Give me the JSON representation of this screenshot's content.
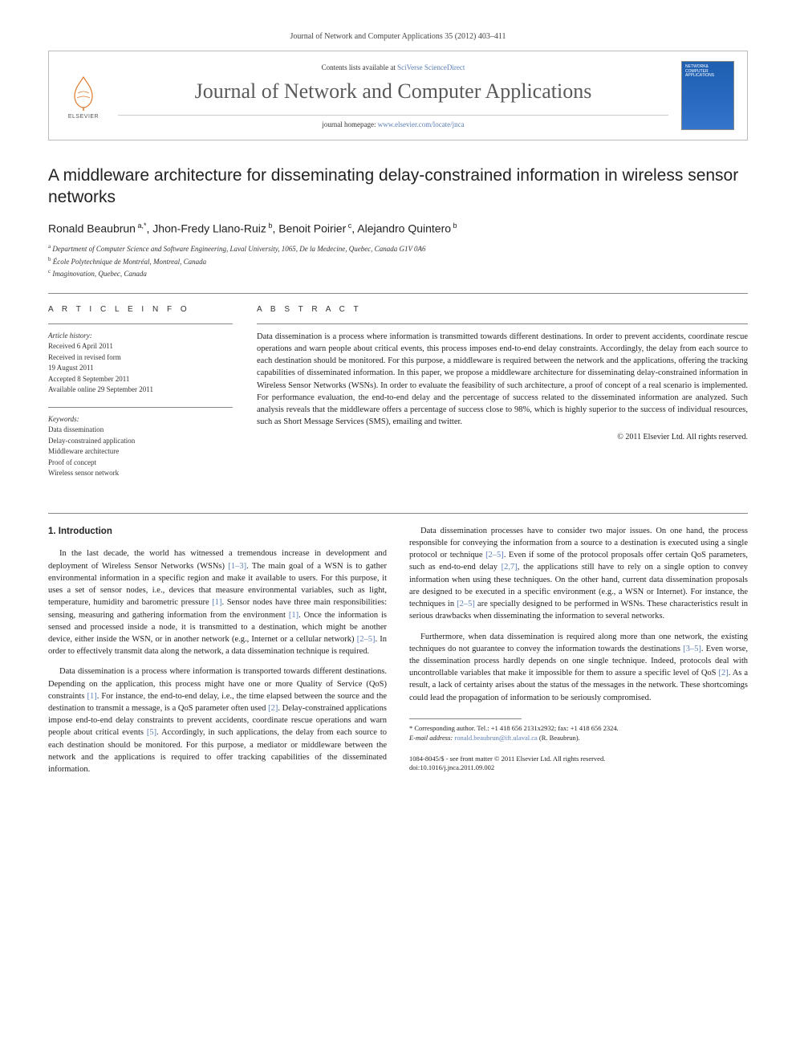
{
  "header_top": "Journal of Network and Computer Applications 35 (2012) 403–411",
  "banner": {
    "contents_prefix": "Contents lists available at ",
    "contents_link": "SciVerse ScienceDirect",
    "journal_title": "Journal of Network and Computer Applications",
    "homepage_prefix": "journal homepage: ",
    "homepage_link": "www.elsevier.com/locate/jnca",
    "elsevier_label": "ELSEVIER",
    "cover_top": "NETWORK& COMPUTER APPLICATIONS"
  },
  "article_title": "A middleware architecture for disseminating delay-constrained information in wireless sensor networks",
  "authors_html": "Ronald Beaubrun <sup>a,</sup>*, Jhon-Fredy Llano-Ruiz <sup>b</sup>, Benoit Poirier <sup>c</sup>, Alejandro Quintero <sup>b</sup>",
  "affiliations": [
    {
      "sup": "a",
      "text": "Department of Computer Science and Software Engineering, Laval University, 1065, De la Medecine, Quebec, Canada G1V 0A6"
    },
    {
      "sup": "b",
      "text": "École Polytechnique de Montréal, Montreal, Canada"
    },
    {
      "sup": "c",
      "text": "Imaginovation, Quebec, Canada"
    }
  ],
  "info_label": "A R T I C L E  I N F O",
  "abs_label": "A B S T R A C T",
  "history": {
    "heading": "Article history:",
    "lines": [
      "Received 6 April 2011",
      "Received in revised form",
      "19 August 2011",
      "Accepted 8 September 2011",
      "Available online 29 September 2011"
    ]
  },
  "keywords": {
    "heading": "Keywords:",
    "items": [
      "Data dissemination",
      "Delay-constrained application",
      "Middleware architecture",
      "Proof of concept",
      "Wireless sensor network"
    ]
  },
  "abstract": "Data dissemination is a process where information is transmitted towards different destinations. In order to prevent accidents, coordinate rescue operations and warn people about critical events, this process imposes end-to-end delay constraints. Accordingly, the delay from each source to each destination should be monitored. For this purpose, a middleware is required between the network and the applications, offering the tracking capabilities of disseminated information. In this paper, we propose a middleware architecture for disseminating delay-constrained information in Wireless Sensor Networks (WSNs). In order to evaluate the feasibility of such architecture, a proof of concept of a real scenario is implemented. For performance evaluation, the end-to-end delay and the percentage of success related to the disseminated information are analyzed. Such analysis reveals that the middleware offers a percentage of success close to 98%, which is highly superior to the success of individual resources, such as Short Message Services (SMS), emailing and twitter.",
  "copyright": "© 2011 Elsevier Ltd. All rights reserved.",
  "section_heading": "1.  Introduction",
  "body": {
    "p1_a": "In the last decade, the world has witnessed a tremendous increase in development and deployment of Wireless Sensor Networks (WSNs) ",
    "p1_ref1": "[1–3]",
    "p1_b": ". The main goal of a WSN is to gather environmental information in a specific region and make it available to users. For this purpose, it uses a set of sensor nodes, i.e., devices that measure environmental variables, such as light, temperature, humidity and barometric pressure ",
    "p1_ref2": "[1]",
    "p1_c": ". Sensor nodes have three main responsibilities: sensing, measuring and gathering information from the environment ",
    "p1_ref3": "[1]",
    "p1_d": ". Once the information is sensed and processed inside a node, it is transmitted to a destination, which might be another device, either inside the WSN, or in another network (e.g., Internet or a cellular network) ",
    "p1_ref4": "[2–5]",
    "p1_e": ". In order to effectively transmit data along the network, a data dissemination technique is required.",
    "p2_a": "Data dissemination is a process where information is transported towards different destinations. Depending on the application, this process might have one or more Quality of Service (QoS) constraints ",
    "p2_ref1": "[1]",
    "p2_b": ". For instance, the end-to-end delay, i.e., the time elapsed between the source and the destination to transmit a message, is a QoS parameter often used ",
    "p2_ref2": "[2]",
    "p2_c": ". Delay-constrained applications impose end-to-end delay constraints to prevent accidents, coordinate rescue operations and warn people about critical events ",
    "p2_ref3": "[5]",
    "p2_d": ". Accordingly, in such applications, the delay from each source to each destination should be monitored. For this purpose, a mediator or middleware between the network and the applications is required to offer tracking capabilities of the disseminated information.",
    "p3_a": "Data dissemination processes have to consider two major issues. On one hand, the process responsible for conveying the information from a source to a destination is executed using a single protocol or technique ",
    "p3_ref1": "[2–5]",
    "p3_b": ". Even if some of the protocol proposals offer certain QoS parameters, such as end-to-end delay ",
    "p3_ref2": "[2,7]",
    "p3_c": ", the applications still have to rely on a single option to convey information when using these techniques. On the other hand, current data dissemination proposals are designed to be executed in a specific environment (e.g., a WSN or Internet). For instance, the techniques in ",
    "p3_ref3": "[2–5]",
    "p3_d": " are specially designed to be performed in WSNs. These characteristics result in serious drawbacks when disseminating the information to several networks.",
    "p4_a": "Furthermore, when data dissemination is required along more than one network, the existing techniques do not guarantee to convey the information towards the destinations ",
    "p4_ref1": "[3–5]",
    "p4_b": ". Even worse, the dissemination process hardly depends on one single technique. Indeed, protocols deal with uncontrollable variables that make it impossible for them to assure a specific level of QoS ",
    "p4_ref2": "[2]",
    "p4_c": ". As a result, a lack of certainty arises about the status of the messages in the network. These shortcomings could lead the propagation of information to be seriously compromised."
  },
  "footnote": {
    "corr": "* Corresponding author. Tel.: +1 418 656 2131x2932; fax: +1 418 656 2324.",
    "email_label": "E-mail address: ",
    "email": "ronald.beaubrun@ift.ulaval.ca",
    "email_who": " (R. Beaubrun)."
  },
  "footer": {
    "line1": "1084-8045/$ - see front matter © 2011 Elsevier Ltd. All rights reserved.",
    "line2": "doi:10.1016/j.jnca.2011.09.002"
  }
}
